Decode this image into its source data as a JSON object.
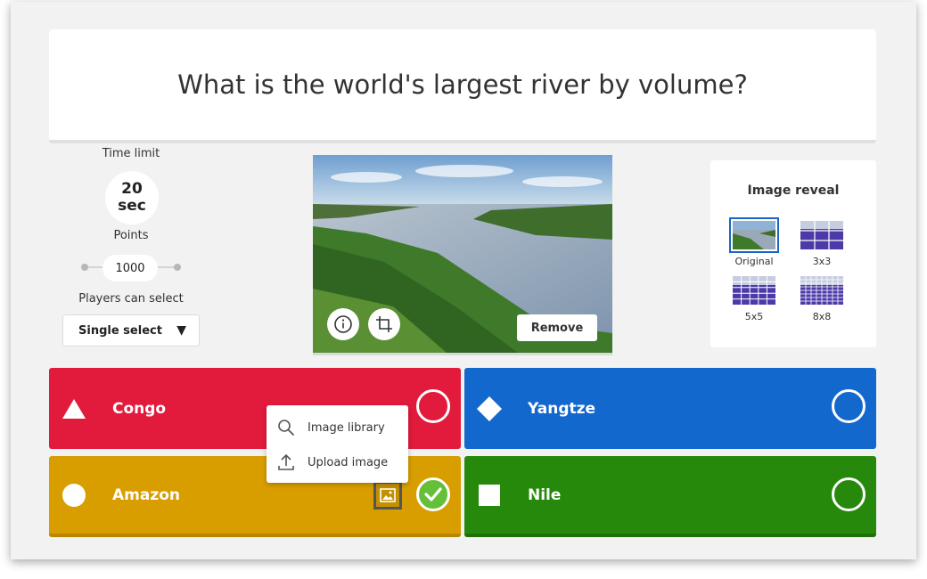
{
  "question": {
    "text": "What is the world's largest river by volume?"
  },
  "settings": {
    "time_limit_label": "Time limit",
    "time_value": "20",
    "time_unit": "sec",
    "points_label": "Points",
    "points_value": "1000",
    "players_label": "Players can select",
    "select_value": "Single select"
  },
  "image": {
    "remove_label": "Remove"
  },
  "reveal": {
    "title": "Image reveal",
    "options": [
      "Original",
      "3x3",
      "5x5",
      "8x8"
    ],
    "selected": "Original"
  },
  "answers": [
    {
      "text": "Congo",
      "shape": "triangle-icon",
      "color": "#e21b3c",
      "correct": false
    },
    {
      "text": "Yangtze",
      "shape": "diamond-icon",
      "color": "#1368ce",
      "correct": false
    },
    {
      "text": "Amazon",
      "shape": "circle-icon",
      "color": "#d89e00",
      "correct": true
    },
    {
      "text": "Nile",
      "shape": "square-icon",
      "color": "#26890c",
      "correct": false
    }
  ],
  "menu": {
    "items": [
      {
        "label": "Image library",
        "icon": "search-icon"
      },
      {
        "label": "Upload image",
        "icon": "upload-icon"
      }
    ]
  },
  "colors": {
    "correct": "#66bf39",
    "selected_outline": "#1a66c2"
  }
}
